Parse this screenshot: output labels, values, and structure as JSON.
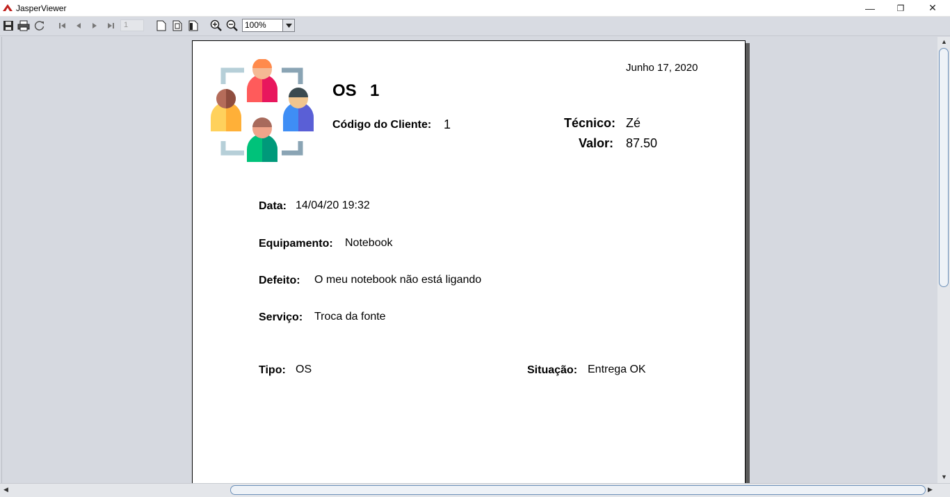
{
  "window": {
    "title": "JasperViewer",
    "minimize_glyph": "—",
    "restore_glyph": "❐",
    "close_glyph": "✕"
  },
  "toolbar": {
    "icons": [
      "save-icon",
      "print-icon",
      "reload-icon",
      "first-page-icon",
      "previous-page-icon",
      "next-page-icon",
      "last-page-icon",
      "actual-size-icon",
      "fit-page-icon",
      "fit-width-icon",
      "zoom-in-icon",
      "zoom-out-icon"
    ],
    "page_number": "1",
    "zoom_value": "100%"
  },
  "report": {
    "date": "Junho 17, 2020",
    "os_label": "OS",
    "os_number": "1",
    "cliente_label": "Código do Cliente:",
    "cliente_value": "1",
    "tecnico_label": "Técnico:",
    "tecnico_value": "Zé",
    "valor_label": "Valor:",
    "valor_value": "87.50",
    "data_label": "Data:",
    "data_value": "14/04/20 19:32",
    "equipamento_label": "Equipamento:",
    "equipamento_value": "Notebook",
    "defeito_label": "Defeito:",
    "defeito_value": "O meu notebook não está ligando",
    "servico_label": "Serviço:",
    "servico_value": "Troca da fonte",
    "tipo_label": "Tipo:",
    "tipo_value": "OS",
    "situacao_label": "Situação:",
    "situacao_value": "Entrega OK"
  },
  "colors": {
    "viewer_bg": "#d6d9e0",
    "scroll_thumb_border": "#6b8fb8",
    "logo_orange": "#ff7b4f",
    "logo_pink": "#e8175d",
    "logo_yellow": "#ffd15c",
    "logo_blue": "#4a7df2",
    "logo_green": "#00c27a"
  }
}
